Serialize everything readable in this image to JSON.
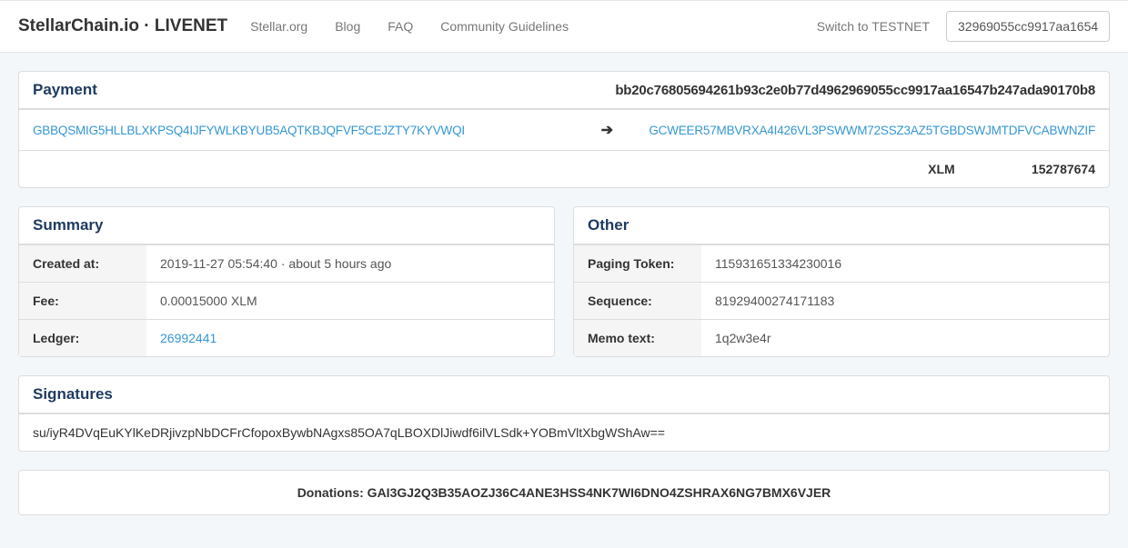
{
  "nav": {
    "brand": "StellarChain.io · LIVENET",
    "links": [
      "Stellar.org",
      "Blog",
      "FAQ",
      "Community Guidelines"
    ],
    "switch": "Switch to TESTNET",
    "search_value": "32969055cc9917aa1654"
  },
  "payment": {
    "title": "Payment",
    "txhash": "bb20c76805694261b93c2e0b77d4962969055cc9917aa16547b247ada90170b8",
    "from": "GBBQSMIG5HLLBLXKPSQ4IJFYWLKBYUB5AQTKBJQFVF5CEJZTY7KYVWQI",
    "to": "GCWEER57MBVRXA4I426VL3PSWWM72SSZ3AZ5TGBDSWJMTDFVCABWNZIF",
    "asset": "XLM",
    "amount": "152787674"
  },
  "summary": {
    "title": "Summary",
    "rows": {
      "created_label": "Created at:",
      "created_value": "2019-11-27 05:54:40 · about 5 hours ago",
      "fee_label": "Fee:",
      "fee_value": "0.00015000 XLM",
      "ledger_label": "Ledger:",
      "ledger_value": "26992441"
    }
  },
  "other": {
    "title": "Other",
    "rows": {
      "paging_label": "Paging Token:",
      "paging_value": "115931651334230016",
      "sequence_label": "Sequence:",
      "sequence_value": "81929400274171183",
      "memo_label": "Memo text:",
      "memo_value": "1q2w3e4r"
    }
  },
  "signatures": {
    "title": "Signatures",
    "value": "su/iyR4DVqEuKYlKeDRjivzpNbDCFrCfopoxBywbNAgxs85OA7qLBOXDlJiwdf6ilVLSdk+YOBmVltXbgWShAw=="
  },
  "donations": "Donations: GAI3GJ2Q3B35AOZJ36C4ANE3HSS4NK7WI6DNO4ZSHRAX6NG7BMX6VJER"
}
